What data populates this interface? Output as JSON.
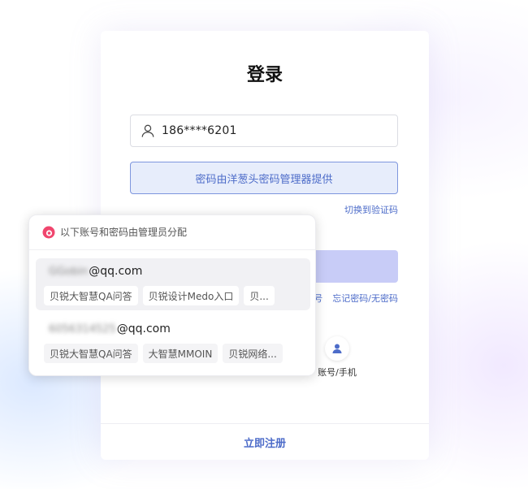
{
  "login": {
    "title": "登录",
    "account_value": "186****6201",
    "password_provided_banner": "密码由洋葱头密码管理器提供",
    "switch_to_code": "切换到验证码",
    "link_partial": "号",
    "forgot_password": "忘记密码/无密码",
    "social_label_account_phone": "账号/手机",
    "register": "立即注册"
  },
  "popup": {
    "header": "以下账号和密码由管理员分配",
    "accounts": [
      {
        "email_hidden": "GGobin",
        "email_domain": "@qq.com",
        "tags": [
          "贝锐大智慧QA问答",
          "贝锐设计Medo入口",
          "贝..."
        ]
      },
      {
        "email_hidden": "6056314525",
        "email_domain": "@qq.com",
        "tags": [
          "贝锐大智慧QA问答",
          "大智慧MMOIN",
          "贝锐网络..."
        ]
      }
    ]
  },
  "colors": {
    "accent": "#4d6cc9",
    "banner_bg": "#e7edfb",
    "login_button": "#c8ccf7",
    "brand_logo": "#f0466e"
  },
  "icons": {
    "account_field": "user-icon",
    "popup_header": "onion-logo-icon",
    "social": "person-icon"
  }
}
